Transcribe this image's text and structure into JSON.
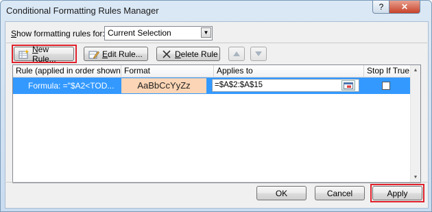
{
  "window": {
    "title": "Conditional Formatting Rules Manager",
    "help_label": "?",
    "close_label": "✕"
  },
  "filter": {
    "label_prefix": "",
    "label_underlined": "S",
    "label_rest": "how formatting rules for:",
    "selected": "Current Selection"
  },
  "toolbar": {
    "new_rule_u": "N",
    "new_rule_rest": "ew Rule...",
    "edit_rule_u": "E",
    "edit_rule_rest": "dit Rule...",
    "delete_rule_u": "D",
    "delete_rule_rest": "elete Rule"
  },
  "grid": {
    "columns": [
      "Rule (applied in order shown)",
      "Format",
      "Applies to",
      "Stop If True"
    ],
    "rows": [
      {
        "rule": "Formula: =\"$A2<TOD...",
        "format_preview": "AaBbCcYyZz",
        "applies_to": "=$A$2:$A$15",
        "stop_if_true": false
      }
    ]
  },
  "footer": {
    "ok_label": "OK",
    "cancel_label": "Cancel",
    "apply_label": "Apply"
  },
  "colors": {
    "selection": "#3399ff",
    "format_fill": "#fbd5b5",
    "highlight": "#e0202a"
  }
}
